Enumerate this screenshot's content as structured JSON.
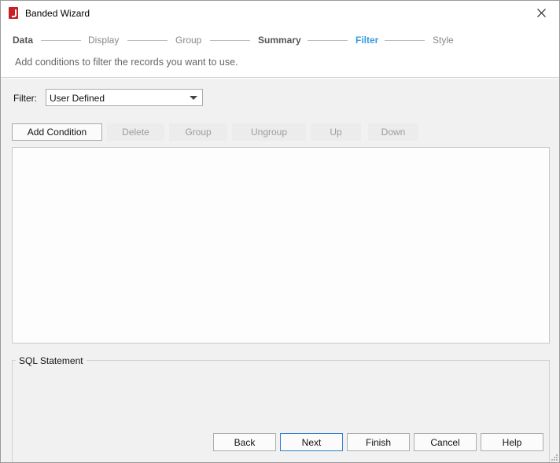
{
  "window": {
    "title": "Banded Wizard",
    "close_icon": "close-icon",
    "app_icon": "app-logo-icon",
    "accent": "#3b9be0"
  },
  "steps": [
    {
      "label": "Data",
      "state": "done"
    },
    {
      "label": "Display",
      "state": "pending"
    },
    {
      "label": "Group",
      "state": "pending"
    },
    {
      "label": "Summary",
      "state": "done"
    },
    {
      "label": "Filter",
      "state": "active"
    },
    {
      "label": "Style",
      "state": "pending"
    }
  ],
  "subtitle": "Add conditions to filter the records you want to use.",
  "filter": {
    "label": "Filter:",
    "selected": "User Defined"
  },
  "actions": {
    "add_condition": "Add Condition",
    "delete": "Delete",
    "group": "Group",
    "ungroup": "Ungroup",
    "up": "Up",
    "down": "Down"
  },
  "sql": {
    "legend": "SQL Statement"
  },
  "footer": {
    "back": "Back",
    "next": "Next",
    "finish": "Finish",
    "cancel": "Cancel",
    "help": "Help"
  }
}
